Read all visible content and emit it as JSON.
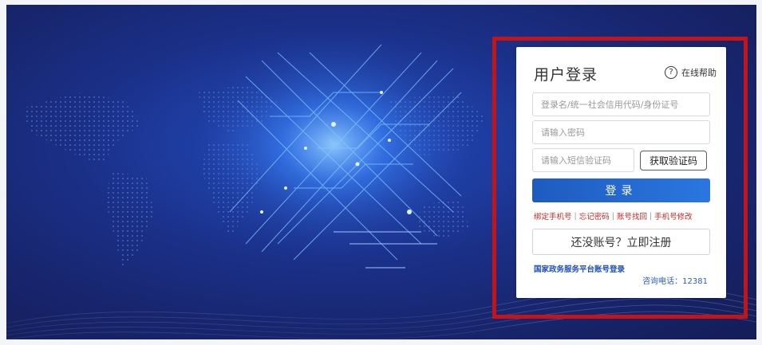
{
  "login": {
    "title": "用户登录",
    "help_label": "在线帮助",
    "help_icon": "?",
    "username_placeholder": "登录名/统一社会信用代码/身份证号",
    "password_placeholder": "请输入密码",
    "sms_placeholder": "请输入短信验证码",
    "sms_button_label": "获取验证码",
    "submit_label": "登录",
    "links": [
      "绑定手机号",
      "忘记密码",
      "账号找回",
      "手机号修改"
    ],
    "link_separator": "|",
    "register_label": "还没账号？立即注册",
    "gov_login_label": "国家政务服务平台账号登录",
    "phone_text": "咨询电话：12381"
  },
  "colors": {
    "banner_dark": "#141d56",
    "banner_glow": "#2e5fd8",
    "primary_button": "#1e5bbf",
    "link_red": "#c7271f",
    "gov_link_blue": "#1f4fb5",
    "highlight_border": "#c3141a"
  }
}
